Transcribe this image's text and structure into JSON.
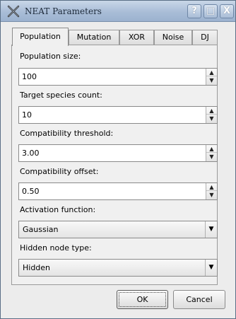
{
  "window": {
    "title": "NEAT Parameters",
    "buttons": {
      "help": "?",
      "maximize": "□",
      "close": "X"
    }
  },
  "tabs": [
    {
      "label": "Population",
      "active": true
    },
    {
      "label": "Mutation",
      "active": false
    },
    {
      "label": "XOR",
      "active": false
    },
    {
      "label": "Noise",
      "active": false
    },
    {
      "label": "DJ",
      "active": false
    }
  ],
  "fields": {
    "population_size": {
      "label": "Population size:",
      "value": "100"
    },
    "target_species_count": {
      "label": "Target species count:",
      "value": "10"
    },
    "compatibility_threshold": {
      "label": "Compatibility threshold:",
      "value": "3.00"
    },
    "compatibility_offset": {
      "label": "Compatibility offset:",
      "value": "0.50"
    },
    "activation_function": {
      "label": "Activation function:",
      "value": "Gaussian"
    },
    "hidden_node_type": {
      "label": "Hidden node type:",
      "value": "Hidden"
    }
  },
  "glyphs": {
    "up": "▲",
    "down": "▼"
  },
  "footer": {
    "ok_label": "OK",
    "cancel_label": "Cancel"
  },
  "colors": {
    "titlebar": "#a9bdd7",
    "window_bg": "#ececec"
  }
}
